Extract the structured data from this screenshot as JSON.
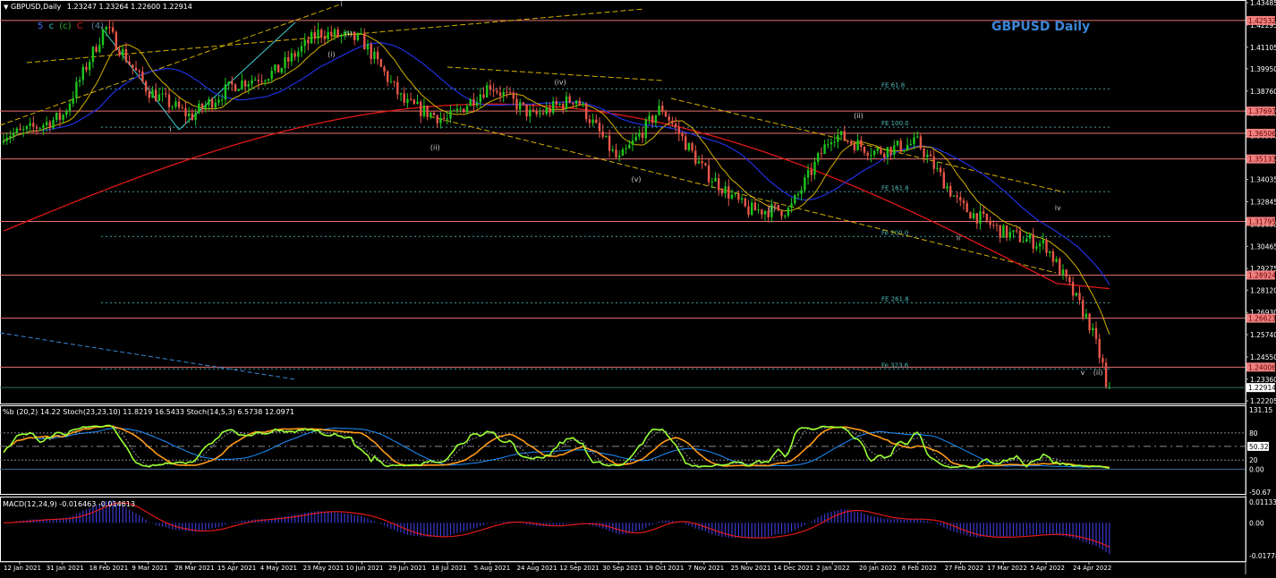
{
  "header": {
    "symbol": "GBPUSD,Daily",
    "ohlc": "1.23247 1.23264 1.22600 1.22914"
  },
  "title": "GBPUSD Daily",
  "wave_count_label": [
    "5",
    "c",
    "(c)",
    "C",
    "(4)"
  ],
  "colors": {
    "bull": "#1fc51f",
    "bear": "#e8564a",
    "ma200": "#e01818",
    "ma_blue": "#2030e0",
    "ma_yellow": "#d4b000",
    "level": "#e87070",
    "level_bg": "#f08080",
    "fib": "#40a0a0",
    "stoch_main": "#99ff33",
    "stoch_signal": "#ff9a1a",
    "stoch_blue": "#1e90ff",
    "macd_line": "#e01818",
    "macd_hist": "#3a3ad0"
  },
  "chart_data": {
    "type": "candlestick",
    "symbol": "GBPUSD",
    "timeframe": "Daily",
    "x_tick_labels": [
      "12 Jan 2021",
      "31 Jan 2021",
      "18 Feb 2021",
      "9 Mar 2021",
      "28 Mar 2021",
      "15 Apr 2021",
      "4 May 2021",
      "23 May 2021",
      "10 Jun 2021",
      "29 Jun 2021",
      "18 Jul 2021",
      "5 Aug 2021",
      "24 Aug 2021",
      "12 Sep 2021",
      "30 Sep 2021",
      "19 Oct 2021",
      "7 Nov 2021",
      "25 Nov 2021",
      "14 Dec 2021",
      "2 Jan 2022",
      "20 Jan 2022",
      "8 Feb 2022",
      "27 Feb 2022",
      "17 Mar 2022",
      "5 Apr 2022",
      "24 Apr 2022"
    ],
    "approx_close_at_ticks": [
      1.365,
      1.374,
      1.422,
      1.388,
      1.374,
      1.391,
      1.398,
      1.419,
      1.415,
      1.381,
      1.372,
      1.391,
      1.374,
      1.384,
      1.35,
      1.379,
      1.345,
      1.324,
      1.324,
      1.365,
      1.355,
      1.36,
      1.326,
      1.312,
      1.305,
      1.264
    ],
    "last_close": 1.22914,
    "ylim": [
      1.22205,
      1.43485
    ],
    "y_tick_labels": [
      "1.43485",
      "1.42295",
      "1.41105",
      "1.39950",
      "1.38760",
      "1.37570",
      "1.36380",
      "1.35190",
      "1.34035",
      "1.32845",
      "1.31655",
      "1.30465",
      "1.29275",
      "1.28120",
      "1.26930",
      "1.25740",
      "1.24550",
      "1.23360",
      "1.22205"
    ],
    "horizontal_levels": [
      "1.42532",
      "1.37693",
      "1.36506",
      "1.35133",
      "1.31795",
      "1.28924",
      "1.26623",
      "1.24006"
    ],
    "current_price_label": "1.22914",
    "fib_levels": [
      {
        "label": "FE 61.8",
        "price": 1.3888
      },
      {
        "label": "FE 100.0",
        "price": 1.3683
      },
      {
        "label": "FE 161.8",
        "price": 1.3338
      },
      {
        "label": "Fe 200.0",
        "price": 1.3099
      },
      {
        "label": "FE 261.8",
        "price": 1.2745
      },
      {
        "label": "Fe 323.6",
        "price": 1.2391
      }
    ],
    "wave_labels": [
      {
        "text": "i",
        "tick": 3.5,
        "price": 1.366
      },
      {
        "text": "i",
        "tick": 7.5,
        "price": 1.433
      },
      {
        "text": "(i)",
        "tick": 7.6,
        "price": 1.417
      },
      {
        "text": "(i)",
        "tick": 7.2,
        "price": 1.406
      },
      {
        "text": "(ii)",
        "tick": 9.6,
        "price": 1.3563
      },
      {
        "text": "(iv)",
        "tick": 12.5,
        "price": 1.391
      },
      {
        "text": "(v)",
        "tick": 14.3,
        "price": 1.3393
      },
      {
        "text": "(i)",
        "tick": 17.5,
        "price": 1.3235
      },
      {
        "text": "(ii)",
        "tick": 19.5,
        "price": 1.3732
      },
      {
        "text": "ii",
        "tick": 21.9,
        "price": 1.308
      },
      {
        "text": "iv",
        "tick": 24.2,
        "price": 1.3238
      },
      {
        "text": "v",
        "tick": 24.8,
        "price": 1.236
      },
      {
        "text": "(ii)",
        "tick": 25.1,
        "price": 1.236
      }
    ],
    "indicators": {
      "stoch_header": "%b (20,2) 14.22  Stoch(23,23,10) 11.8219 16.5433  Stoch(14,5,3) 6.5738 12.0971",
      "stoch_axis": [
        "131.15",
        "80",
        "50.32",
        "0.00",
        "20",
        "-50.67"
      ],
      "stoch_ylim": [
        -50.67,
        131.15
      ],
      "macd_header": "MACD(12,24,9) -0.016463 -0.014613",
      "macd_axis": [
        "0.011337",
        "0.00",
        "-0.017787"
      ],
      "macd_ylim": [
        -0.017787,
        0.011337
      ]
    }
  }
}
